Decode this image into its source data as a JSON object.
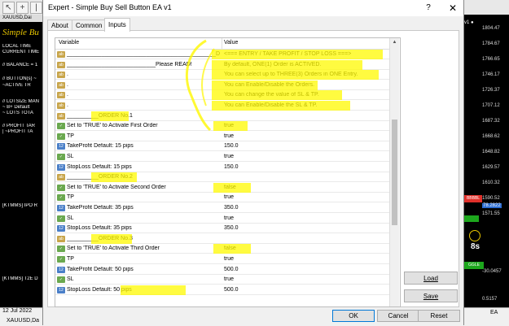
{
  "terminal": {
    "chart_left": {
      "header": "XAUUSD,Dai",
      "brand": "Simple Bu",
      "lines": [
        "LOCAL TIME",
        "CURRENT TIME",
        "// BALANCE = 1",
        "// BUTTON(s) ~",
        "  ~ACTIVE TR",
        "// LOTSIZE MAN",
        "  ~ B+ Default",
        "  ~ LOTS TOTA",
        "// PROFIT TAR",
        "  | ~PROFIT TA",
        "[KTMMS] IPO R",
        "[KTMMS] T2E D"
      ]
    },
    "chart_right": {
      "header": "v1 ●",
      "ticks": [
        "1804.47",
        "1784.67",
        "1766.65",
        "1746.17",
        "1726.37",
        "1707.12",
        "1687.32",
        "1668.62",
        "1648.82",
        "1629.57",
        "1610.32",
        "1590.52",
        "1571.55"
      ],
      "badge_red": "BBBBL",
      "price_highlight": "78.2822",
      "big_text": "8s",
      "toggle": "GGLE",
      "bottom_value": "-30.0457",
      "bottom_value2": "0.5157"
    },
    "status": {
      "date": "12 Jul 2022",
      "chart_tab": "XAUUSD,Da",
      "right_mark": "EA"
    }
  },
  "dialog": {
    "title": "Expert - Simple Buy Sell Button EA v1",
    "help": "?",
    "close": "✕",
    "tabs": [
      {
        "label": "About"
      },
      {
        "label": "Common"
      },
      {
        "label": "Inputs"
      }
    ],
    "grid": {
      "col_variable": "Variable",
      "col_value": "Value",
      "rows": [
        {
          "icon": "ab",
          "variable": "_______________________________________________D",
          "value": "<=== ENTRY / TAKE PROFIT / STOP LOSS ===>"
        },
        {
          "icon": "ab",
          "variable": "____________________________Please READ!",
          "value": "By default, ONE(1) Order is ACTIVED."
        },
        {
          "icon": "ab",
          "variable": ".",
          "value": "You can select up to THREE(3) Orders in ONE Entry."
        },
        {
          "icon": "ab",
          "variable": ".",
          "value": "You can Enable/Disable the Orders."
        },
        {
          "icon": "ab",
          "variable": ".",
          "value": "You can change the value of SL & TP."
        },
        {
          "icon": "ab",
          "variable": ".",
          "value": "You can Enable/Disable the SL & TP."
        },
        {
          "icon": "ab",
          "variable": "__________ORDER No.1",
          "value": ""
        },
        {
          "icon": "bool",
          "variable": "Set to 'TRUE' to Activate First Order",
          "value": "true"
        },
        {
          "icon": "bool",
          "variable": "TP",
          "value": "true"
        },
        {
          "icon": "num",
          "variable": "TakeProfit Default: 15 pips",
          "value": "150.0"
        },
        {
          "icon": "bool",
          "variable": "SL",
          "value": "true"
        },
        {
          "icon": "num",
          "variable": "StopLoss Default: 15 pips",
          "value": "150.0"
        },
        {
          "icon": "ab",
          "variable": "__________ORDER No.2",
          "value": ""
        },
        {
          "icon": "bool",
          "variable": "Set to 'TRUE' to Activate Second Order",
          "value": "false"
        },
        {
          "icon": "bool",
          "variable": "TP",
          "value": "true"
        },
        {
          "icon": "num",
          "variable": "TakeProfit Default: 35 pips",
          "value": "350.0"
        },
        {
          "icon": "bool",
          "variable": "SL",
          "value": "true"
        },
        {
          "icon": "num",
          "variable": "StopLoss Default: 35 pips",
          "value": "350.0"
        },
        {
          "icon": "ab",
          "variable": "__________ORDER No.3",
          "value": ""
        },
        {
          "icon": "bool",
          "variable": "Set to 'TRUE' to Activate Third Order",
          "value": "false"
        },
        {
          "icon": "bool",
          "variable": "TP",
          "value": "true"
        },
        {
          "icon": "num",
          "variable": "TakeProfit Default: 50 pips",
          "value": "500.0"
        },
        {
          "icon": "bool",
          "variable": "SL",
          "value": "true"
        },
        {
          "icon": "num",
          "variable": "StopLoss Default: 50 pips",
          "value": "500.0"
        }
      ]
    },
    "buttons": {
      "load": "Load",
      "save": "Save",
      "ok": "OK",
      "cancel": "Cancel",
      "reset": "Reset"
    }
  },
  "colors": {
    "highlight": "#fff700",
    "icon_string": "#c8a54a",
    "icon_bool": "#6aa84f",
    "icon_number": "#4a7fc8"
  }
}
